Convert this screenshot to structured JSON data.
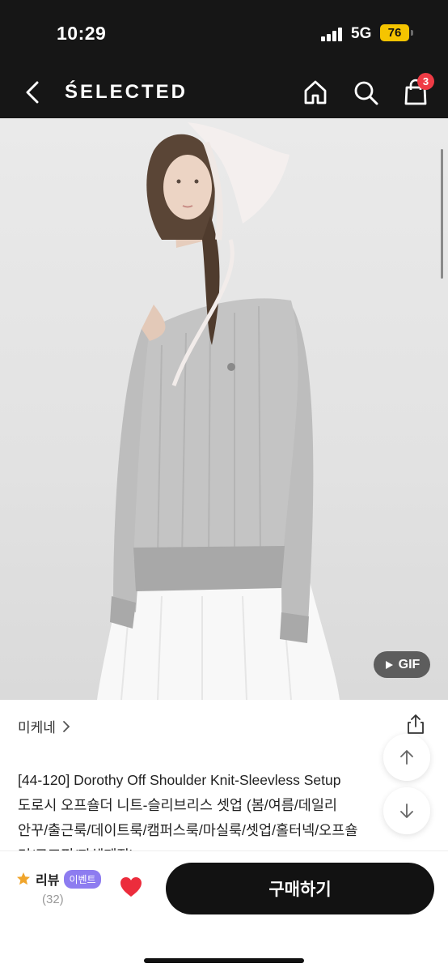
{
  "status": {
    "time": "10:29",
    "network": "5G",
    "battery": "76"
  },
  "header": {
    "brand": "ŚELECTED",
    "cart_count": "3"
  },
  "media": {
    "gif_label": "GIF"
  },
  "product": {
    "brand_name": "미케네",
    "title_lines": [
      "[44-120] Dorothy Off Shoulder Knit-Sleevless Setup",
      "도로시 오프숄더 니트-슬리브리스 셋업 (봄/여름/데일리",
      "안꾸/출근룩/데이트룩/캠퍼스룩/마실룩/셋업/홀터넥/오프숄",
      "더/로즈핑/자체제작)"
    ]
  },
  "bottom": {
    "review_label": "리뷰",
    "event_badge": "이벤트",
    "review_count": "(32)",
    "buy_label": "구매하기"
  },
  "colors": {
    "dark_bg": "#161616",
    "badge_red": "#ef3b45",
    "heart_red": "#ec2c3c",
    "event_purple": "#8d7cf0",
    "star_orange": "#f0a52c"
  }
}
